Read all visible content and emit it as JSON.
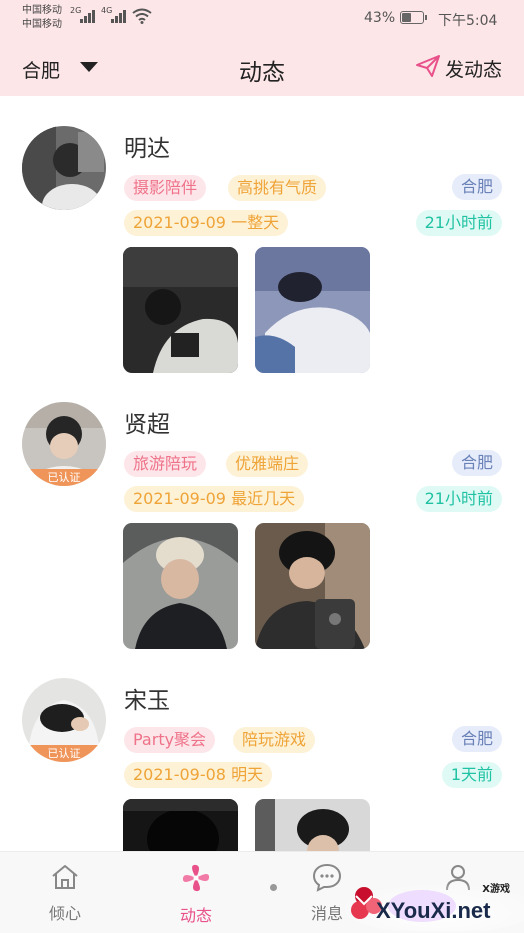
{
  "status_bar": {
    "carrier_1": "中国移动",
    "carrier_2": "中国移动",
    "net_1": "2G",
    "net_2": "4G",
    "battery": "43%",
    "battery_level": 0.43,
    "time": "下午5:04"
  },
  "header": {
    "city": "合肥",
    "title": "动态",
    "post_label": "发动态"
  },
  "posts": [
    {
      "name": "明达",
      "verified": "",
      "tags": [
        "摄影陪伴",
        "高挑有气质"
      ],
      "city": "合肥",
      "date_line": "2021-09-09 一整天",
      "time_ago": "21小时前"
    },
    {
      "name": "贤超",
      "verified": "已认证",
      "tags": [
        "旅游陪玩",
        "优雅端庄"
      ],
      "city": "合肥",
      "date_line": "2021-09-09 最近几天",
      "time_ago": "21小时前"
    },
    {
      "name": "宋玉",
      "verified": "已认证",
      "tags": [
        "Party聚会",
        "陪玩游戏"
      ],
      "city": "合肥",
      "date_line": "2021-09-08 明天",
      "time_ago": "1天前"
    }
  ],
  "tabs": [
    {
      "label": "倾心",
      "icon": "house-icon"
    },
    {
      "label": "动态",
      "icon": "pinwheel-icon",
      "active": true
    },
    {
      "label": "消息",
      "icon": "chat-bubble-icon"
    },
    {
      "label": "",
      "icon": "person-icon"
    }
  ],
  "watermark": {
    "small": "X游戏",
    "big": "XYouXi.net"
  },
  "colors": {
    "header_bg": "#fde6e8",
    "accent": "#e8518a",
    "tag_pink": "#ee7389",
    "tag_yellow": "#efa438",
    "city_chip": "#6a82b8",
    "time_teal": "#21c2a3"
  }
}
